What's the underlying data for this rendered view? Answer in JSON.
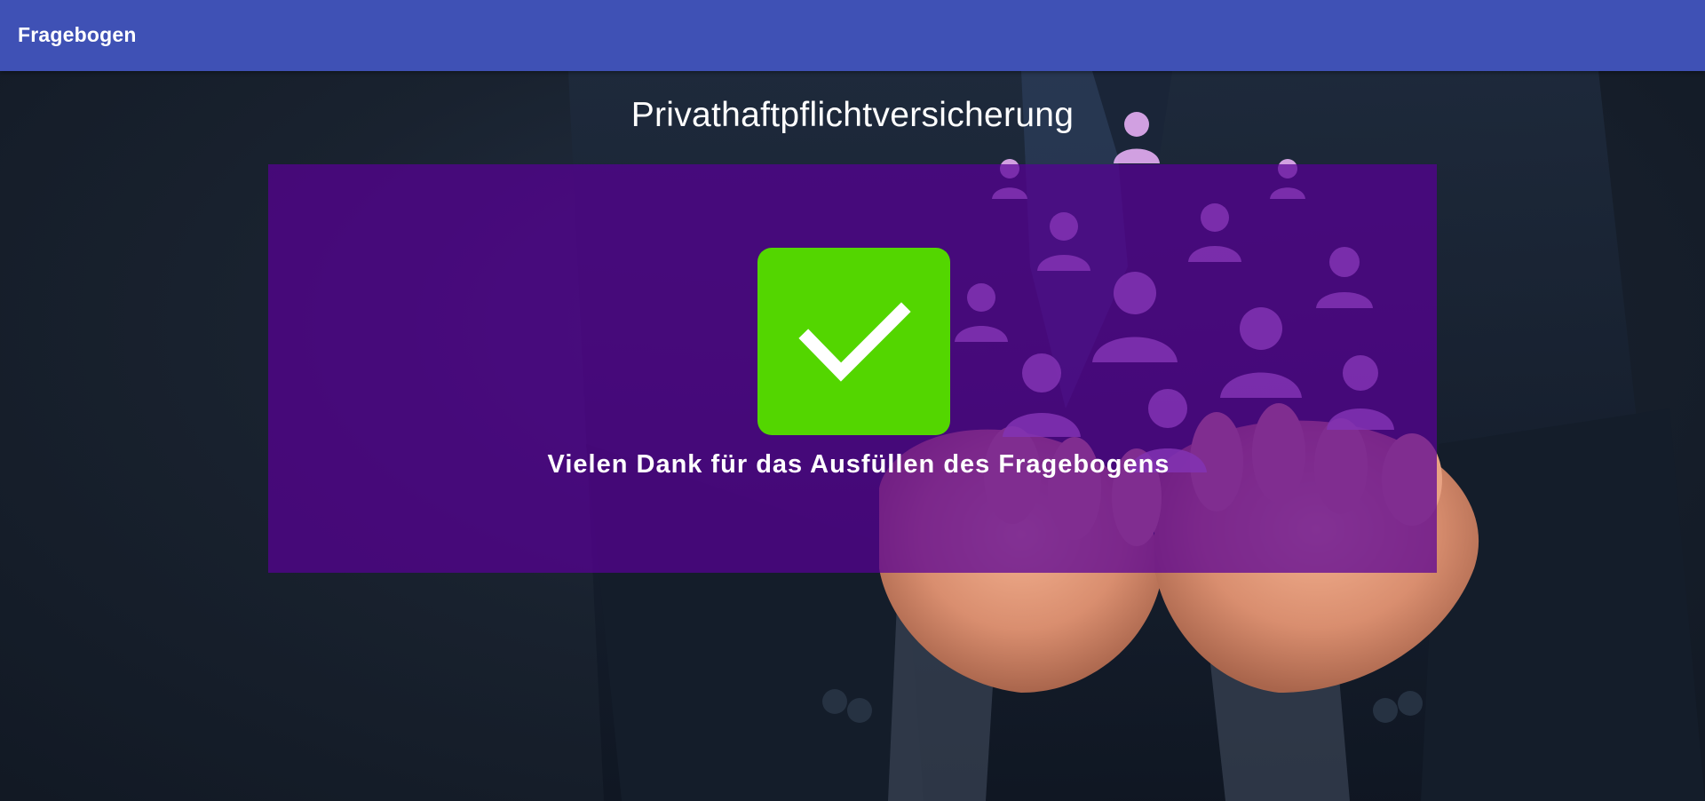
{
  "appbar": {
    "title": "Fragebogen"
  },
  "page": {
    "title": "Privathaftpflichtversicherung",
    "message": "Vielen Dank für das Ausfüllen des Fragebogens"
  },
  "colors": {
    "appbar": "#3f51b5",
    "panel": "#580096",
    "check_box": "#53d600",
    "text": "#ffffff"
  },
  "icons": {
    "check": "check-icon"
  }
}
